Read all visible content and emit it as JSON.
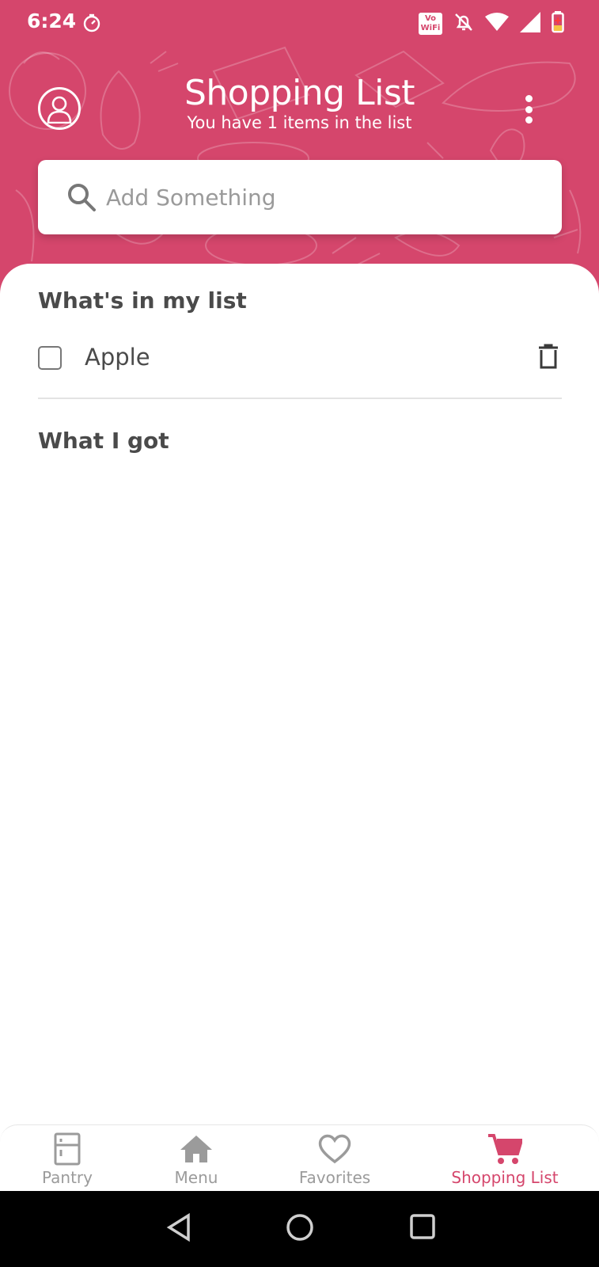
{
  "colors": {
    "accent": "#d5466c",
    "text": "#4a4a4a",
    "muted": "#9b9b9b"
  },
  "status_bar": {
    "time": "6:24",
    "icons": [
      "timer-icon",
      "vowifi-icon",
      "bell-off-icon",
      "wifi-icon",
      "signal-icon",
      "battery-icon"
    ],
    "vowifi_text": "Vo WiFi"
  },
  "header": {
    "title": "Shopping List",
    "subtitle": "You have 1 items in the list",
    "left_icon": "user-avatar-icon",
    "right_icon": "more-vertical-icon"
  },
  "search": {
    "placeholder": "Add Something",
    "value": "",
    "icon": "search-icon"
  },
  "list": {
    "to_buy_title": "What's in my list",
    "items": [
      {
        "label": "Apple",
        "checked": false
      }
    ],
    "got_title": "What I got",
    "got_items": []
  },
  "tabs": [
    {
      "label": "Pantry",
      "icon": "fridge-icon",
      "active": false
    },
    {
      "label": "Menu",
      "icon": "home-icon",
      "active": false
    },
    {
      "label": "Favorites",
      "icon": "heart-icon",
      "active": false
    },
    {
      "label": "Shopping List",
      "icon": "cart-icon",
      "active": true
    }
  ],
  "system_nav": [
    "back-icon",
    "home-circle-icon",
    "recents-icon"
  ]
}
